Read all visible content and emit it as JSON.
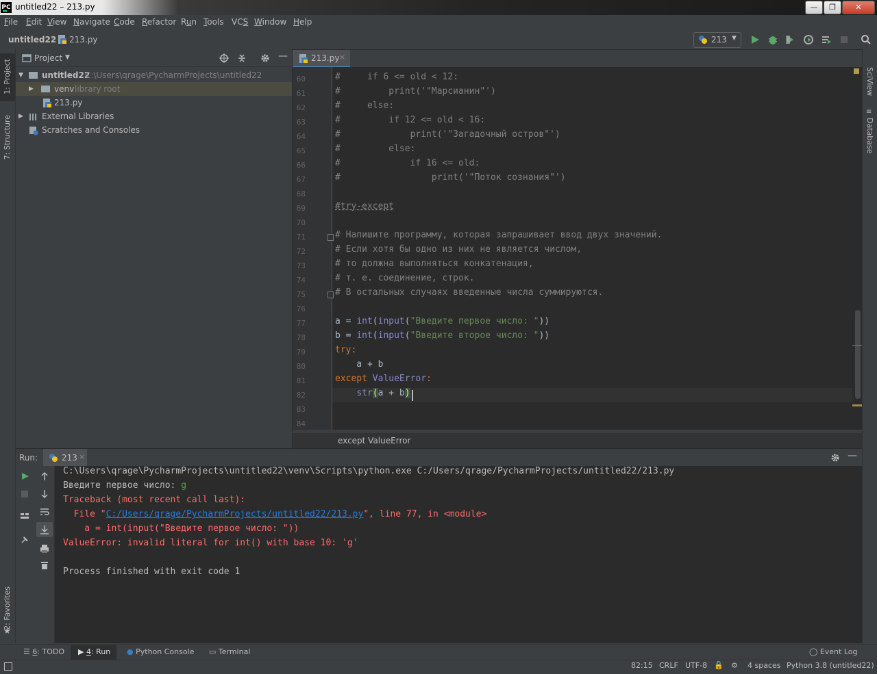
{
  "window": {
    "title": "untitled22 – 213.py",
    "app_badge": "PC",
    "controls": {
      "minimize": "—",
      "maximize": "❐",
      "close": "✕"
    }
  },
  "menu": [
    {
      "label": "File",
      "mnemonic": "F"
    },
    {
      "label": "Edit",
      "mnemonic": "E"
    },
    {
      "label": "View",
      "mnemonic": "V"
    },
    {
      "label": "Navigate",
      "mnemonic": "N"
    },
    {
      "label": "Code",
      "mnemonic": "C"
    },
    {
      "label": "Refactor",
      "mnemonic": "R"
    },
    {
      "label": "Run",
      "mnemonic": "u"
    },
    {
      "label": "Tools",
      "mnemonic": "T"
    },
    {
      "label": "VCS",
      "mnemonic": "S"
    },
    {
      "label": "Window",
      "mnemonic": "W"
    },
    {
      "label": "Help",
      "mnemonic": "H"
    }
  ],
  "navbar": {
    "project": "untitled22",
    "file": "213.py",
    "run_config": "213"
  },
  "left_stripe": {
    "project_tab": "1: Project",
    "structure_tab": "7: Structure",
    "favorites_tab": "2: Favorites"
  },
  "right_stripe": {
    "sciview_tab": "SciView",
    "database_tab": "Database"
  },
  "project_panel": {
    "title": "Project",
    "tree": {
      "root_name": "untitled22",
      "root_path": "C:\\Users\\qrage\\PycharmProjects\\untitled22",
      "venv_name": "venv",
      "venv_hint": "library root",
      "file_name": "213.py",
      "ext_libs": "External Libraries",
      "scratches": "Scratches and Consoles"
    }
  },
  "editor": {
    "tab_label": "213.py",
    "line_numbers": [
      "60",
      "61",
      "62",
      "63",
      "64",
      "65",
      "66",
      "67",
      "68",
      "69",
      "70",
      "71",
      "72",
      "73",
      "74",
      "75",
      "76",
      "77",
      "78",
      "79",
      "80",
      "81",
      "82",
      "83",
      "84"
    ],
    "lines": {
      "l60": "#     if 6 <= old < 12:",
      "l61": "#         print('\"Марсианин\"')",
      "l62": "#     else:",
      "l63": "#         if 12 <= old < 16:",
      "l64": "#             print('\"Загадочный остров\"')",
      "l65": "#         else:",
      "l66": "#             if 16 <= old:",
      "l67": "#                 print('\"Поток сознания\"')",
      "l69": "#try-except",
      "l71": "# Напишите программу, которая запрашивает ввод двух значений.",
      "l72": "# Если хотя бы одно из них не является числом,",
      "l73": "# то должна выполняться конкатенация,",
      "l74": "# т. е. соединение, строк.",
      "l75": "# В остальных случаях введенные числа суммируются.",
      "l77_a": "a = ",
      "l77_int": "int",
      "l77_p1": "(",
      "l77_input": "input",
      "l77_p2": "(",
      "l77_str": "\"Введите первое число: \"",
      "l77_end": "))",
      "l78_a": "b = ",
      "l78_int": "int",
      "l78_p1": "(",
      "l78_input": "input",
      "l78_p2": "(",
      "l78_str": "\"Введите второе число: \"",
      "l78_end": "))",
      "l79_try": "try",
      "l79_colon": ":",
      "l80": "    a + b",
      "l81_except": "except ",
      "l81_err": "ValueError",
      "l81_colon": ":",
      "l82_indent": "    ",
      "l82_str": "str",
      "l82_p1": "(",
      "l82_body": "a + b",
      "l82_p2": ")"
    },
    "breadcrumb": "except ValueError"
  },
  "run_panel": {
    "label": "Run:",
    "tab": "213",
    "output": {
      "cmd": "C:\\Users\\qrage\\PycharmProjects\\untitled22\\venv\\Scripts\\python.exe C:/Users/qrage/PycharmProjects/untitled22/213.py",
      "prompt": "Введите первое число: ",
      "user_input": "g",
      "tb_head": "Traceback (most recent call last):",
      "tb_file_pre": "  File \"",
      "tb_file_link": "C:/Users/qrage/PycharmProjects/untitled22/213.py",
      "tb_file_post": "\", line 77, in <module>",
      "tb_code": "    a = int(input(\"Введите первое число: \"))",
      "tb_error": "ValueError: invalid literal for int() with base 10: 'g'",
      "exit": "Process finished with exit code 1"
    }
  },
  "tool_tabs": {
    "todo_num": "6",
    "todo": ": TODO",
    "run_num": "4",
    "run": ": Run",
    "python_console": "Python Console",
    "terminal": "Terminal",
    "event_log": "Event Log"
  },
  "status": {
    "position": "82:15",
    "line_sep": "CRLF",
    "encoding": "UTF-8",
    "indent": "4 spaces",
    "interpreter": "Python 3.8 (untitled22)"
  },
  "colors": {
    "accent": "#4a88c7",
    "run_green": "#59a869",
    "error_red": "#ff6b68",
    "link_blue": "#287bde",
    "comment": "#808080",
    "keyword": "#cc7832",
    "string": "#6a8759"
  }
}
